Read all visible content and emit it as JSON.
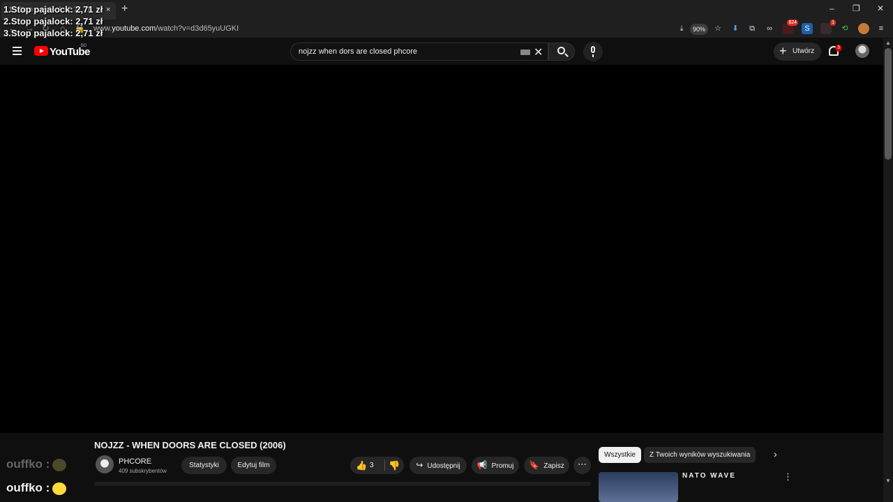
{
  "browser": {
    "tab_title": "1. Stop pajalock: 2,71 zł",
    "tab_close": "×",
    "new_tab": "+",
    "url_prefix": "www.",
    "url_host": "youtube.com",
    "url_path": "/watch?v=d3d65yuUGKI",
    "zoom": "90%",
    "ext_badges": [
      "624",
      "1"
    ],
    "window_controls": [
      "–",
      "❐",
      "✕"
    ]
  },
  "overlay": {
    "lines": [
      "1.Stop pajalock: 2,71 zł",
      "2.Stop pajalock: 2,71 zł",
      "3.Stop pajalock: 2,71 zł"
    ]
  },
  "header": {
    "wordmark": "YouTube",
    "country": "BD",
    "search_query": "nojzz when dors are closed phcore",
    "clear_glyph": "✕",
    "create_label": "Utwórz",
    "create_glyph": "+",
    "notifications": "3"
  },
  "video": {
    "title": "NOJZZ - WHEN DOORS ARE CLOSED (2006)",
    "channel": "PHCORE",
    "subscribers": "409 subskrybentów",
    "actions": {
      "stats": "Statystyki",
      "edit": "Edytuj film",
      "likes": "3",
      "share": "Udostępnij",
      "promote": "Promuj",
      "save": "Zapisz",
      "more": "⋯"
    }
  },
  "sidebar": {
    "chips": [
      "Wszystkie",
      "Z Twoich wyników wyszukiwania"
    ],
    "next_glyph": "›",
    "recommendation_title": "NATO WAVE",
    "more_glyph": "⋮"
  },
  "chat": {
    "faded_user": "ouffko :",
    "user": "ouffko :"
  }
}
